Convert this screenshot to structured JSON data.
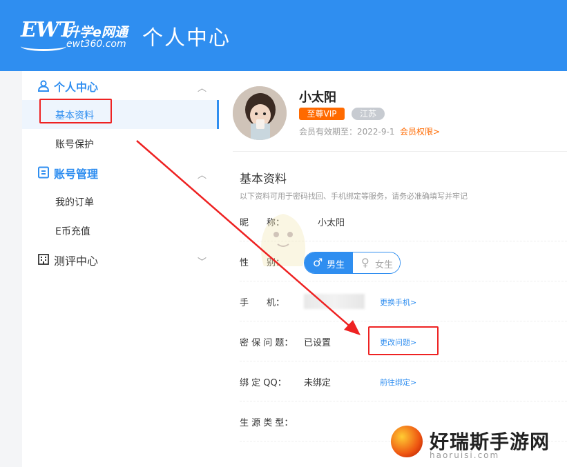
{
  "header": {
    "logo_ewt": "EWT",
    "logo_cn": "升学e网通",
    "logo_url": "ewt360.com",
    "title": "个人中心"
  },
  "sidebar": {
    "groups": [
      {
        "label": "个人中心",
        "icon": "user-icon",
        "items": [
          "基本资料",
          "账号保护"
        ]
      },
      {
        "label": "账号管理",
        "icon": "list-icon",
        "items": [
          "我的订单",
          "E币充值"
        ]
      },
      {
        "label": "测评中心",
        "icon": "building-icon",
        "items": []
      }
    ]
  },
  "profile": {
    "name": "小太阳",
    "vip_badge": "至尊VIP",
    "province_badge": "江苏",
    "member_expiry": "会员有效期至：2022-9-1",
    "member_link": "会员权限>"
  },
  "section": {
    "title": "基本资料",
    "desc": "以下资料可用于密码找回、手机绑定等服务，请务必准确填写并牢记"
  },
  "fields": {
    "nickname_label": "昵　　称：",
    "nickname_value": "小太阳",
    "gender_label": "性　　别：",
    "gender_male": "男生",
    "gender_female": "女生",
    "gender_selected": "男生",
    "phone_label": "手　　机：",
    "phone_action": "更换手机>",
    "security_label": "密 保 问 题：",
    "security_value": "已设置",
    "security_action": "更改问题>",
    "qq_label": "绑 定  QQ：",
    "qq_value": "未绑定",
    "qq_action": "前往绑定>",
    "source_label": "生 源 类 型："
  },
  "watermark": {
    "text": "好瑞斯手游网",
    "sub": "haoruisi.com"
  },
  "colors": {
    "primary": "#2f8ef0",
    "vip": "#ff6a00",
    "annotation": "#ee2222"
  }
}
